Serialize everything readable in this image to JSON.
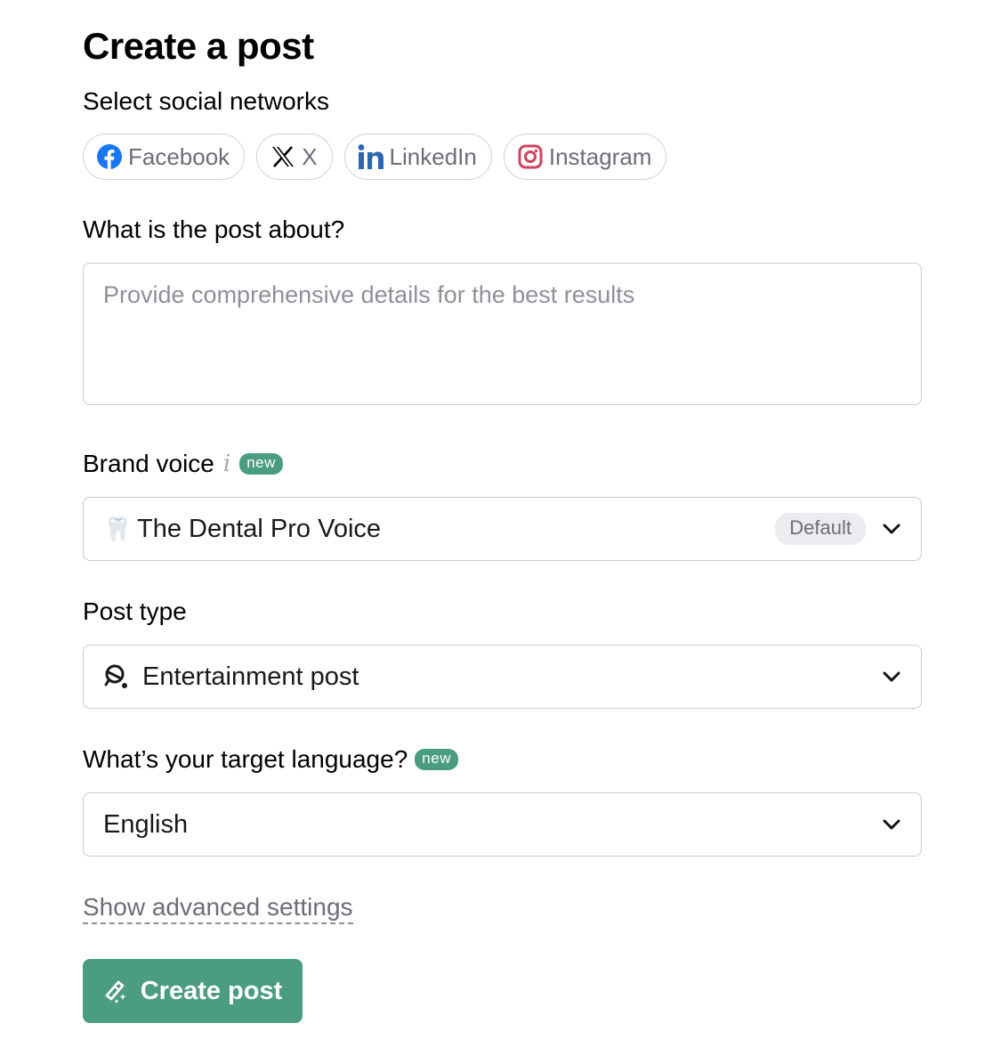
{
  "page": {
    "title": "Create a post"
  },
  "networks": {
    "label": "Select social networks",
    "items": [
      {
        "name": "Facebook",
        "icon": "facebook-icon",
        "color": "#1877f2"
      },
      {
        "name": "X",
        "icon": "x-icon",
        "color": "#000000"
      },
      {
        "name": "LinkedIn",
        "icon": "linkedin-icon",
        "color": "#2867b2"
      },
      {
        "name": "Instagram",
        "icon": "instagram-icon",
        "color": "#d0425e"
      }
    ]
  },
  "about": {
    "label": "What is the post about?",
    "value": "",
    "placeholder": "Provide comprehensive details for the best results"
  },
  "brand_voice": {
    "label": "Brand voice",
    "info_icon": "info-icon",
    "badge": "new",
    "emoji": "🦷",
    "value": "The Dental Pro Voice",
    "default_badge": "Default"
  },
  "post_type": {
    "label": "Post type",
    "icon": "entertainment-icon",
    "value": "Entertainment post"
  },
  "language": {
    "label": "What’s your target language?",
    "badge": "new",
    "value": "English"
  },
  "advanced": {
    "label": "Show advanced settings"
  },
  "submit": {
    "label": "Create post",
    "icon": "magic-wand-icon"
  },
  "colors": {
    "accent": "#4a9d80",
    "muted_text": "#6b6e78",
    "border": "#c9cbd1"
  }
}
